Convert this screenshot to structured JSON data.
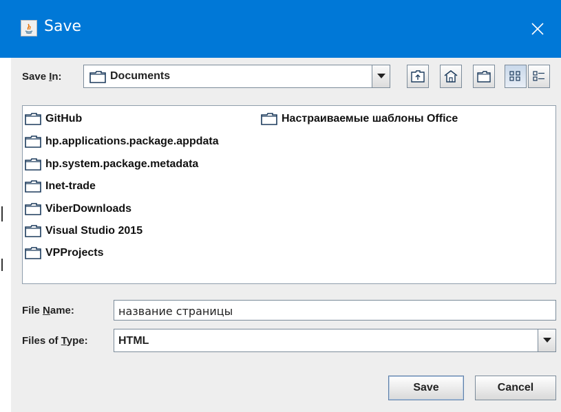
{
  "window": {
    "title": "Save",
    "close_glyph": "✕"
  },
  "save_in": {
    "label_prefix": "Save ",
    "label_mnemonic": "I",
    "label_suffix": "n:",
    "value": "Documents"
  },
  "toolbar": {
    "buttons": [
      {
        "name": "up-one-level-icon"
      },
      {
        "name": "home-icon"
      },
      {
        "name": "new-folder-icon"
      },
      {
        "name": "list-view-icon"
      },
      {
        "name": "details-view-icon"
      }
    ]
  },
  "files": {
    "column1": [
      "GitHub",
      "hp.applications.package.appdata",
      "hp.system.package.metadata",
      "Inet-trade",
      "ViberDownloads",
      "Visual Studio 2015",
      "VPProjects"
    ],
    "column2": [
      "Настраиваемые шаблоны Office"
    ]
  },
  "file_name": {
    "label_prefix": "File ",
    "label_mnemonic": "N",
    "label_suffix": "ame:",
    "value": "название страницы"
  },
  "file_type": {
    "label_prefix": "Files of ",
    "label_mnemonic": "T",
    "label_suffix": "ype:",
    "value": "HTML"
  },
  "buttons": {
    "save": "Save",
    "cancel": "Cancel"
  },
  "colors": {
    "titlebar": "#0078d7",
    "panel": "#eeeeee"
  }
}
